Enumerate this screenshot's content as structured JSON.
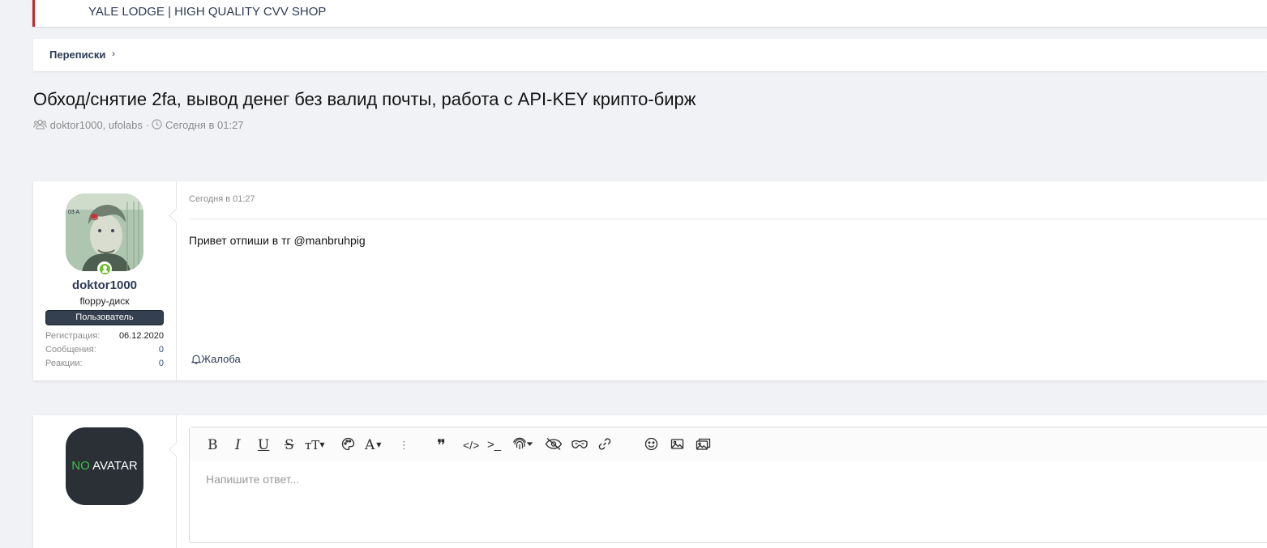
{
  "notice": {
    "text": "YALE LODGE | HIGH QUALITY CVV SHOP"
  },
  "breadcrumb": {
    "item": "Переписки",
    "separator": "›"
  },
  "thread": {
    "title": "Обход/снятие 2fa, вывод денег без валид почты, работа с API-KEY крипто-бирж",
    "participants": "doktor1000, ufolabs",
    "dot": "·",
    "date": "Сегодня в 01:27"
  },
  "message": {
    "user": {
      "name": "doktor1000",
      "title": "floppy-диск",
      "banner": "Пользователь",
      "stats": [
        {
          "label": "Регистрация:",
          "value": "06.12.2020"
        },
        {
          "label": "Сообщения:",
          "value": "0"
        },
        {
          "label": "Реакции:",
          "value": "0"
        }
      ]
    },
    "date": "Сегодня в 01:27",
    "body": "Привет отпиши в тг @manbruhpig",
    "report_label": "Жалоба"
  },
  "reply": {
    "avatar": {
      "part1": "NO",
      "part2": " AVATAR"
    },
    "placeholder": "Напишите ответ...",
    "toolbar": {
      "bold": "B",
      "italic": "I",
      "underline": "U",
      "strike": "S",
      "text_size": "тT",
      "font_family": "A",
      "more": "⋮",
      "quote": "❞",
      "code": "</>",
      "inline_code": ">_"
    }
  },
  "colors": {
    "accent_red": "#c8282d",
    "online_green": "#6cbf2a",
    "link_blue": "#2d3a55",
    "banner_bg": "#34404f"
  }
}
